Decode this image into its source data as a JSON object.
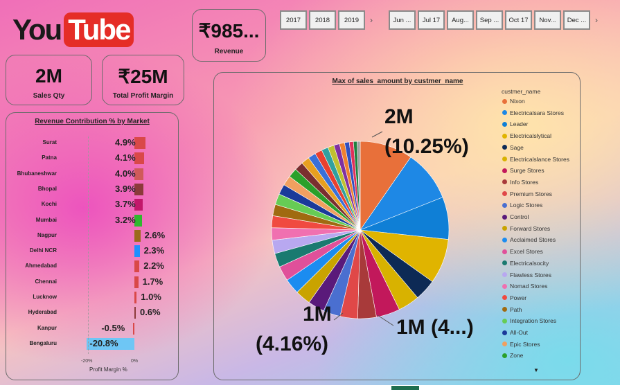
{
  "brand": {
    "you": "You",
    "tube": "Tube"
  },
  "kpis": {
    "revenue": {
      "value": "₹985...",
      "label": "Revenue"
    },
    "sales_qty": {
      "value": "2M",
      "label": "Sales Qty"
    },
    "profit_margin": {
      "value": "₹25M",
      "label": "Total Profit Margin"
    }
  },
  "year_slicer": {
    "items": [
      "2017",
      "2018",
      "2019"
    ],
    "next_icon": "chevron-right-icon"
  },
  "month_slicer": {
    "items": [
      "Jun ...",
      "Jul 17",
      "Aug...",
      "Sep ...",
      "Oct 17",
      "Nov...",
      "Dec ..."
    ],
    "next_icon": "chevron-right-icon"
  },
  "market_chart": {
    "title": "Revenue Contribution % by Market",
    "xlabel": "Profit Margin %",
    "ticks": [
      "-20%",
      "0%"
    ],
    "rows": [
      {
        "city": "Surat",
        "label": "4.9%",
        "value": 4.9,
        "color": "#d94848"
      },
      {
        "city": "Patna",
        "label": "4.1%",
        "value": 4.1,
        "color": "#d94848"
      },
      {
        "city": "Bhubaneshwar",
        "label": "4.0%",
        "value": 4.0,
        "color": "#d05a5a"
      },
      {
        "city": "Bhopal",
        "label": "3.9%",
        "value": 3.9,
        "color": "#8b3a3a"
      },
      {
        "city": "Kochi",
        "label": "3.7%",
        "value": 3.7,
        "color": "#c2186b"
      },
      {
        "city": "Mumbai",
        "label": "3.2%",
        "value": 3.2,
        "color": "#2fb82f"
      },
      {
        "city": "Nagpur",
        "label": "2.6%",
        "value": 2.6,
        "color": "#9a6a1a"
      },
      {
        "city": "Delhi NCR",
        "label": "2.3%",
        "value": 2.3,
        "color": "#1e90ff"
      },
      {
        "city": "Ahmedabad",
        "label": "2.2%",
        "value": 2.2,
        "color": "#d94848"
      },
      {
        "city": "Chennai",
        "label": "1.7%",
        "value": 1.7,
        "color": "#d94848"
      },
      {
        "city": "Lucknow",
        "label": "1.0%",
        "value": 1.0,
        "color": "#d94848"
      },
      {
        "city": "Hyderabad",
        "label": "0.6%",
        "value": 0.6,
        "color": "#8b3a3a"
      },
      {
        "city": "Kanpur",
        "label": "-0.5%",
        "value": -0.5,
        "color": "#d94848"
      },
      {
        "city": "Bengaluru",
        "label": "-20.8%",
        "value": -20.8,
        "color": "#6ec6f5"
      }
    ]
  },
  "chart_data": {
    "type": "pie",
    "title": "Max of sales_amount by custmer_name",
    "legend_title": "custmer_name",
    "legend": [
      "Nixon",
      "Electricalsara Stores",
      "Leader",
      "Electricalslytical",
      "Sage",
      "Electricalslance Stores",
      "Surge Stores",
      "Info Stores",
      "Premium Stores",
      "Logic Stores",
      "Control",
      "Forward Stores",
      "Acclaimed Stores",
      "Excel Stores",
      "Electricalsocity",
      "Flawless Stores",
      "Nomad Stores",
      "Power",
      "Path",
      "Integration Stores",
      "All-Out",
      "Epic Stores",
      "Zone"
    ],
    "colors": [
      "#e8703a",
      "#1e88e5",
      "#0f7fd6",
      "#e0b400",
      "#0d2a55",
      "#d8b200",
      "#c2185b",
      "#a83a3a",
      "#e04848",
      "#4a6fd0",
      "#5a1a7a",
      "#c9a300",
      "#1b8cf0",
      "#e0509a",
      "#1a7a70",
      "#b8a8f0",
      "#f070b0",
      "#f04a40",
      "#a06a10",
      "#66cc55",
      "#1a3a9a",
      "#f0a060",
      "#2aa02a"
    ],
    "values": [
      10.25,
      9.9,
      8.2,
      8.7,
      4.16,
      4.16,
      4.6,
      3.6,
      3.4,
      3.3,
      3.2,
      3.0,
      3.0,
      2.9,
      2.7,
      2.6,
      2.4,
      2.3,
      2.2,
      2.1,
      2.0,
      1.9,
      1.8,
      1.7,
      1.6,
      1.5,
      1.4,
      1.3,
      1.2,
      1.1,
      1.0,
      0.9,
      0.8,
      0.7,
      0.6
    ],
    "extra_colors": [
      "#7a2f2f",
      "#e8a020",
      "#3a70d8",
      "#e84030",
      "#30a0a0",
      "#c0c030",
      "#8030a0",
      "#f08030",
      "#3050c0",
      "#e0305a",
      "#208040",
      "#a0a0a0"
    ],
    "labels": {
      "top_value": "2M",
      "top_pct": "(10.25%)",
      "bottom_right": "1M (4...)",
      "bottom_left_value": "1M",
      "bottom_left_pct": "(4.16%)"
    }
  }
}
